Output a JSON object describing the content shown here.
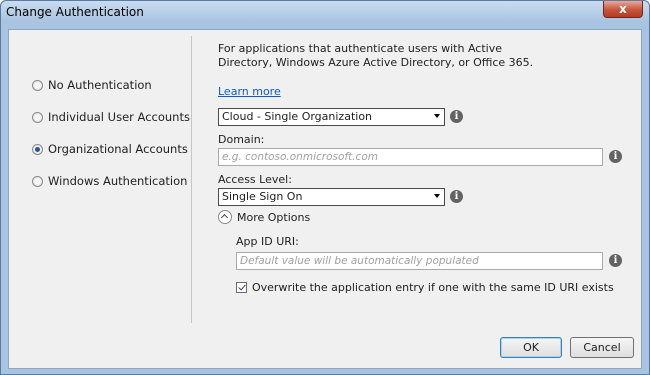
{
  "window": {
    "title": "Change Authentication",
    "close_glyph": "x"
  },
  "auth_options": [
    {
      "label": "No Authentication",
      "selected": false
    },
    {
      "label": "Individual User Accounts",
      "selected": false
    },
    {
      "label": "Organizational Accounts",
      "selected": true
    },
    {
      "label": "Windows Authentication",
      "selected": false
    }
  ],
  "panel": {
    "description": "For applications that authenticate users with Active Directory, Windows Azure Active Directory, or Office 365.",
    "learn_more": "Learn more",
    "org_type": {
      "value": "Cloud - Single Organization"
    },
    "domain": {
      "label": "Domain:",
      "placeholder": "e.g. contoso.onmicrosoft.com"
    },
    "access_level": {
      "label": "Access Level:",
      "value": "Single Sign On"
    },
    "more_options": {
      "label": "More Options",
      "expanded": true
    },
    "app_id_uri": {
      "label": "App ID URI:",
      "placeholder": "Default value will be automatically populated"
    },
    "overwrite": {
      "label": "Overwrite the application entry if one with the same ID URI exists",
      "checked": true
    }
  },
  "buttons": {
    "ok": "OK",
    "cancel": "Cancel"
  },
  "icons": {
    "info": "i"
  }
}
